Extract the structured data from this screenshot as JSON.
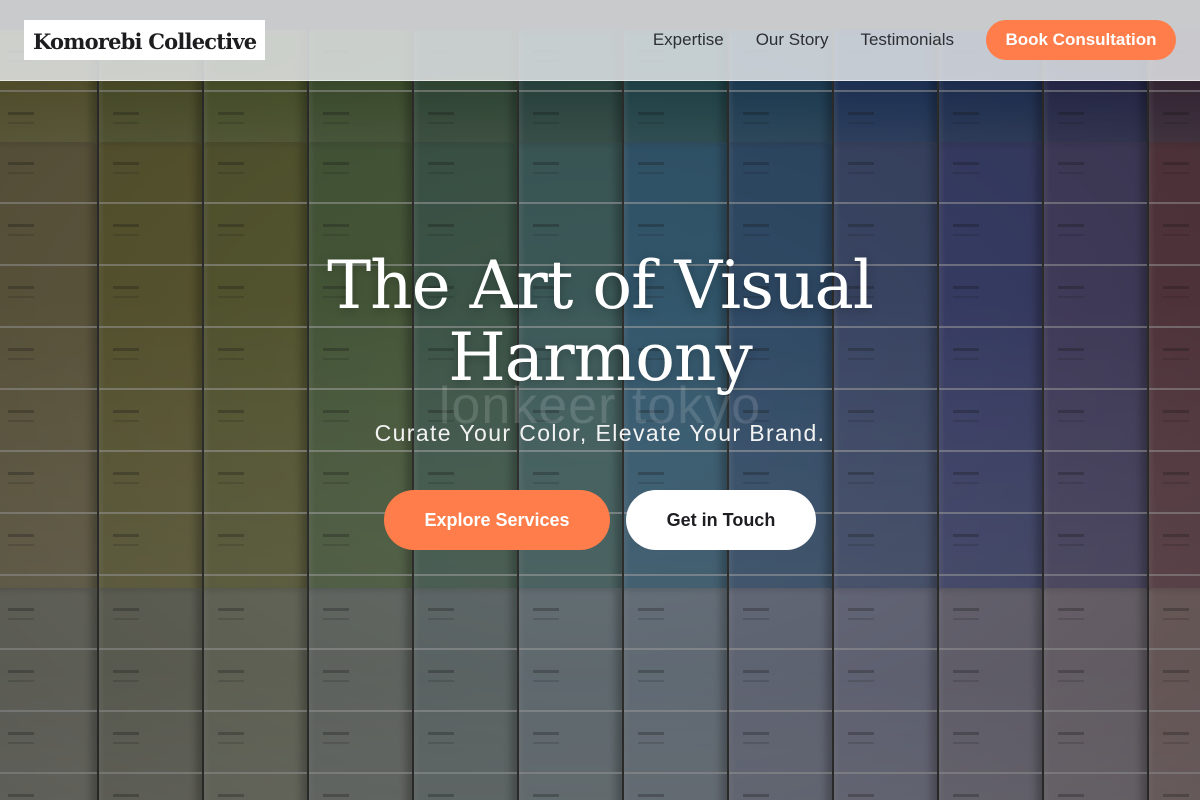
{
  "brand": {
    "name": "Komorebi Collective"
  },
  "nav": {
    "links": [
      "Expertise",
      "Our Story",
      "Testimonials"
    ],
    "cta_label": "Book Consultation"
  },
  "hero": {
    "title": "The Art of Visual Harmony",
    "subtitle": "Curate Your Color, Elevate Your Brand.",
    "watermark": "lonkeer tokyo",
    "primary_button": "Explore Services",
    "secondary_button": "Get in Touch"
  },
  "colors": {
    "accent": "#fe7d4a",
    "header_bg": "#ebeef0",
    "text_dark": "#1e1e22"
  },
  "swatches": {
    "top": [
      "#8f8a4a",
      "#7a7f3e",
      "#75823f",
      "#5f7c45",
      "#4a7052",
      "#3e6a60",
      "#2f6a73",
      "#2b5f86",
      "#2c4f8c",
      "#2e4a86",
      "#3b3f78",
      "#5a3e58"
    ],
    "middle": [
      "#9a8f66",
      "#8f8a4e",
      "#87894d",
      "#6f8a5a",
      "#5f8570",
      "#5e8c8a",
      "#4f87a8",
      "#4b74a0",
      "#5c6fa0",
      "#5a62a2",
      "#6b6396",
      "#8a5a66"
    ],
    "bottom": [
      "#a7a89a",
      "#9ea08d",
      "#a4a791",
      "#a0a8a0",
      "#98a6a6",
      "#9fb0b8",
      "#a2b2c2",
      "#a0a8c0",
      "#a2a6c2",
      "#a6a2b6",
      "#b0a4b2",
      "#b89c9c"
    ]
  }
}
